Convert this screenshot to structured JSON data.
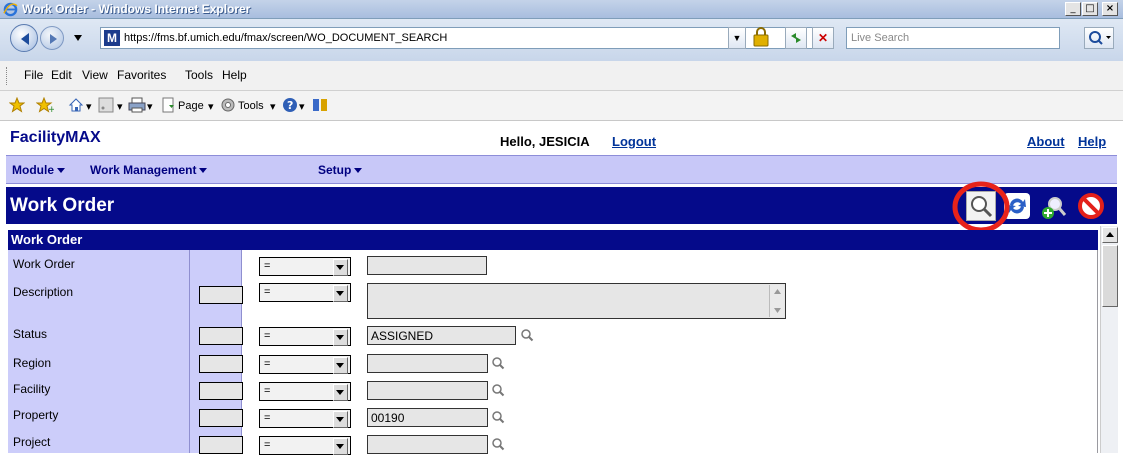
{
  "window": {
    "title": "Work Order - Windows Internet Explorer",
    "minimize_label": "_",
    "maximize_label": "□",
    "close_label": "×"
  },
  "address_bar": {
    "url": "https://fms.bf.umich.edu/fmax/screen/WO_DOCUMENT_SEARCH",
    "site_icon_letter": "M"
  },
  "search_box": {
    "placeholder": "Live Search"
  },
  "menu": {
    "file": "File",
    "edit": "Edit",
    "view": "View",
    "favorites": "Favorites",
    "tools": "Tools",
    "help": "Help"
  },
  "toolbar": {
    "page_label": "Page",
    "tools_label": "Tools"
  },
  "app": {
    "brand": "FacilityMAX",
    "greeting": "Hello, JESICIA",
    "logout": "Logout",
    "about": "About",
    "help": "Help"
  },
  "modules": {
    "module": "Module",
    "work_management": "Work Management",
    "setup": "Setup"
  },
  "page": {
    "title": "Work Order",
    "section_title": "Work Order"
  },
  "form": {
    "fields": [
      {
        "label": "Work Order",
        "operator": "=",
        "value": ""
      },
      {
        "label": "Description",
        "operator": "=",
        "value": ""
      },
      {
        "label": "Status",
        "operator": "=",
        "value": "ASSIGNED"
      },
      {
        "label": "Region",
        "operator": "=",
        "value": ""
      },
      {
        "label": "Facility",
        "operator": "=",
        "value": ""
      },
      {
        "label": "Property",
        "operator": "=",
        "value": "00190"
      },
      {
        "label": "Project",
        "operator": "=",
        "value": ""
      }
    ]
  },
  "colors": {
    "banner": "#050a8a",
    "module_bar": "#c8c8f8",
    "label_column": "#cccdfa",
    "highlight_circle": "#e8231a",
    "link": "#003399"
  },
  "icons": {
    "search_action": "magnifier-icon",
    "refresh_action": "refresh-icon",
    "add_search_action": "zoom-add-icon",
    "cancel_action": "cancel-icon",
    "lookup": "lookup-magnifier-icon"
  }
}
